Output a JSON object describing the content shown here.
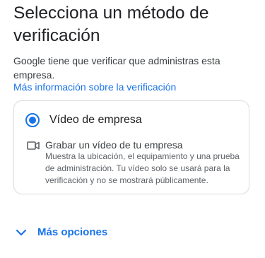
{
  "header": {
    "title": "Selecciona un método de verificación"
  },
  "intro": {
    "description": "Google tiene que verificar que administras esta empresa.",
    "learn_more_link": "Más información sobre la verificación"
  },
  "options": [
    {
      "label": "Vídeo de empresa",
      "selected": true,
      "detail": {
        "icon": "video-camera-icon",
        "title": "Grabar un vídeo de tu empresa",
        "body": "Muestra la ubicación, el equipamiento y una prueba de administración. Tu vídeo solo se usará para la verificación y no se mostrará públicamente."
      }
    }
  ],
  "more_options": {
    "label": "Más opciones",
    "icon": "chevron-down-icon"
  },
  "colors": {
    "accent": "#1a73e8",
    "text_primary": "#202124",
    "text_secondary": "#5f6368",
    "border": "#dadce0"
  }
}
